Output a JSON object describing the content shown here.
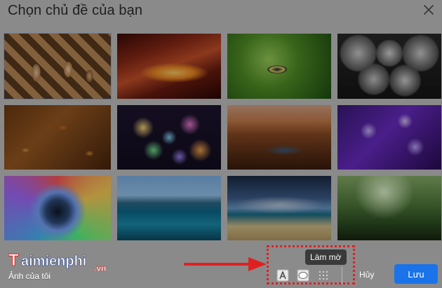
{
  "dialog": {
    "title": "Chọn chủ đề của bạn"
  },
  "themes": [
    {
      "name": "chess",
      "selected": true
    },
    {
      "name": "canyon-glow",
      "selected": false
    },
    {
      "name": "caterpillar",
      "selected": false
    },
    {
      "name": "pipes",
      "selected": false
    },
    {
      "name": "autumn-leaves",
      "selected": false
    },
    {
      "name": "bokeh-lights",
      "selected": false
    },
    {
      "name": "river-canyon",
      "selected": false
    },
    {
      "name": "jellyfish",
      "selected": false
    },
    {
      "name": "color-droplet",
      "selected": false
    },
    {
      "name": "lake-trees",
      "selected": false
    },
    {
      "name": "beach-sunset",
      "selected": false
    },
    {
      "name": "forest-sunlight",
      "selected": false
    }
  ],
  "footer": {
    "my_photos_label": "Ảnh của tôi",
    "tooltip": "Làm mờ",
    "cancel_label": "Hủy",
    "save_label": "Lưu"
  },
  "watermark": {
    "text": "Taimienphi",
    "suffix": ".vn"
  },
  "colors": {
    "primary": "#1a73e8",
    "annotation": "#e02020",
    "selected_outline": "#4e7fd0"
  },
  "icons": {
    "close": "close-icon",
    "text_style": "text-style-icon",
    "vignette": "vignette-icon",
    "blur": "blur-icon",
    "arrow": "arrow-right-icon"
  }
}
